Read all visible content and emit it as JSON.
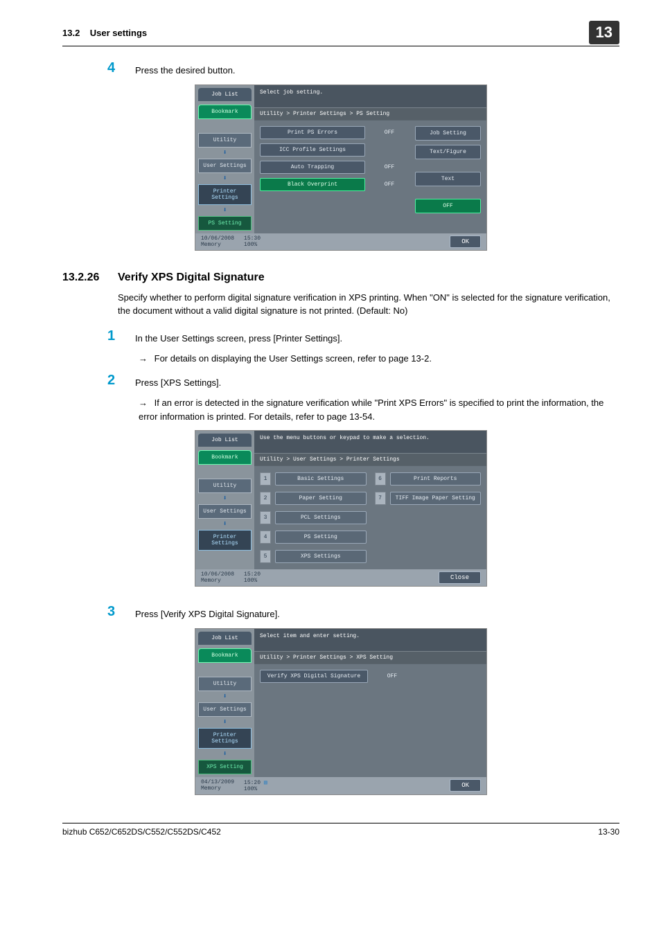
{
  "header": {
    "section": "13.2",
    "title": "User settings",
    "chapter": "13"
  },
  "step4": {
    "num": "4",
    "text": "Press the desired button."
  },
  "section2": {
    "number": "13.2.26",
    "title": "Verify XPS Digital Signature",
    "body": "Specify whether to perform digital signature verification in XPS printing. When \"ON\" is selected for the signature verification, the document without a valid digital signature is not printed. (Default: No)"
  },
  "step1": {
    "num": "1",
    "text": "In the User Settings screen, press [Printer Settings].",
    "sub": "For details on displaying the User Settings screen, refer to page 13-2."
  },
  "step2": {
    "num": "2",
    "text": "Press [XPS Settings].",
    "sub": "If an error is detected in the signature verification while \"Print XPS Errors\" is specified to print the information, the error information is printed. For details, refer to page 13-54."
  },
  "step3": {
    "num": "3",
    "text": "Press [Verify XPS Digital Signature]."
  },
  "footer": {
    "left": "bizhub C652/C652DS/C552/C552DS/C452",
    "right": "13-30"
  },
  "screen1": {
    "side": {
      "joblist": "Job List",
      "bookmark": "Bookmark",
      "utility": "Utility",
      "user": "User Settings",
      "printer": "Printer Settings",
      "ps": "PS Setting"
    },
    "msg": "Select job setting.",
    "crumb": "Utility > Printer Settings > PS Setting",
    "rows": {
      "r1_label": "Print PS Errors",
      "r1_val": "OFF",
      "r2_label": "ICC Profile Settings",
      "r3_label": "Auto Trapping",
      "r3_val": "OFF",
      "r4_label": "Black Overprint",
      "r4_val": "OFF"
    },
    "right": {
      "a": "Job Setting",
      "b": "Text/Figure",
      "c": "Text",
      "d": "OFF"
    },
    "date": "10/06/2008",
    "time": "15:30",
    "mem": "Memory",
    "pct": "100%",
    "ok": "OK"
  },
  "screen2": {
    "side": {
      "joblist": "Job List",
      "bookmark": "Bookmark",
      "utility": "Utility",
      "user": "User Settings",
      "printer": "Printer Settings"
    },
    "msg": "Use the menu buttons or keypad to make a selection.",
    "crumb": "Utility > User Settings > Printer Settings",
    "items": {
      "n1": "1",
      "l1": "Basic Settings",
      "n2": "2",
      "l2": "Paper Setting",
      "n3": "3",
      "l3": "PCL Settings",
      "n4": "4",
      "l4": "PS Setting",
      "n5": "5",
      "l5": "XPS Settings",
      "n6": "6",
      "l6": "Print Reports",
      "n7": "7",
      "l7": "TIFF Image Paper Setting"
    },
    "date": "10/06/2008",
    "time": "15:20",
    "mem": "Memory",
    "pct": "100%",
    "close": "Close"
  },
  "screen3": {
    "side": {
      "joblist": "Job List",
      "bookmark": "Bookmark",
      "utility": "Utility",
      "user": "User Settings",
      "printer": "Printer Settings",
      "xps": "XPS Setting"
    },
    "msg": "Select item and enter setting.",
    "crumb": "Utility > Printer Settings > XPS Setting",
    "row": {
      "label": "Verify XPS Digital Signature",
      "val": "OFF"
    },
    "date": "04/13/2009",
    "time": "15:20",
    "mem": "Memory",
    "pct": "100%",
    "ok": "OK"
  }
}
